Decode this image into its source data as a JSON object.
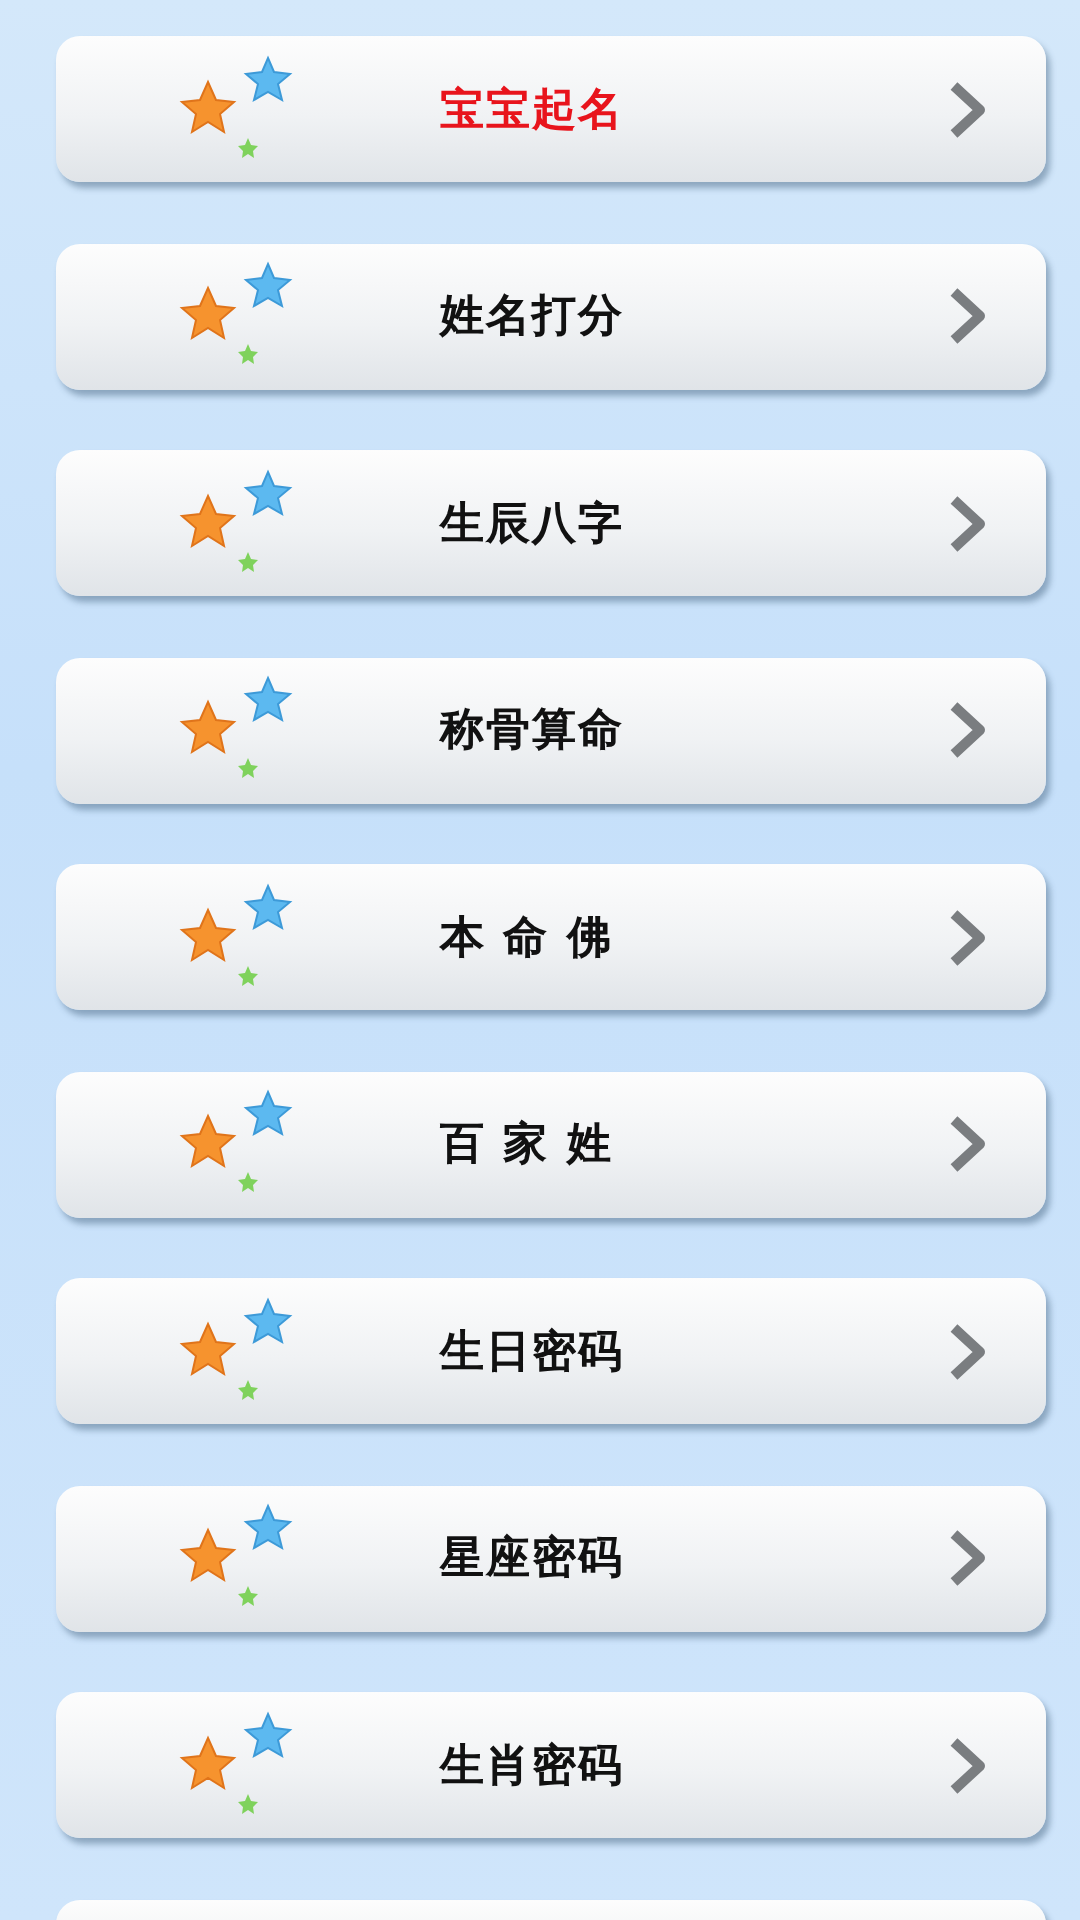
{
  "menu": [
    {
      "label": "宝宝起名",
      "selected": true
    },
    {
      "label": "姓名打分",
      "selected": false
    },
    {
      "label": "生辰八字",
      "selected": false
    },
    {
      "label": "称骨算命",
      "selected": false
    },
    {
      "label": "本 命 佛",
      "selected": false
    },
    {
      "label": "百 家 姓",
      "selected": false
    },
    {
      "label": "生日密码",
      "selected": false
    },
    {
      "label": "星座密码",
      "selected": false
    },
    {
      "label": "生肖密码",
      "selected": false
    }
  ]
}
